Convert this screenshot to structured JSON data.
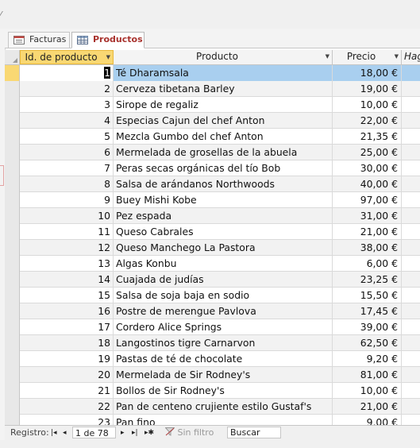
{
  "tabs": [
    {
      "label": "Facturas",
      "active": false
    },
    {
      "label": "Productos",
      "active": true
    }
  ],
  "columns": {
    "id": "Id. de producto",
    "name": "Producto",
    "price": "Precio",
    "extra": "Hag"
  },
  "rows": [
    {
      "id": "1",
      "name": "Té Dharamsala",
      "price": "18,00 €"
    },
    {
      "id": "2",
      "name": "Cerveza tibetana Barley",
      "price": "19,00 €"
    },
    {
      "id": "3",
      "name": "Sirope de regaliz",
      "price": "10,00 €"
    },
    {
      "id": "4",
      "name": "Especias Cajun del chef Anton",
      "price": "22,00 €"
    },
    {
      "id": "5",
      "name": "Mezcla Gumbo del chef Anton",
      "price": "21,35 €"
    },
    {
      "id": "6",
      "name": "Mermelada de grosellas de la abuela",
      "price": "25,00 €"
    },
    {
      "id": "7",
      "name": "Peras secas orgánicas del tío Bob",
      "price": "30,00 €"
    },
    {
      "id": "8",
      "name": "Salsa de arándanos Northwoods",
      "price": "40,00 €"
    },
    {
      "id": "9",
      "name": "Buey Mishi Kobe",
      "price": "97,00 €"
    },
    {
      "id": "10",
      "name": "Pez espada",
      "price": "31,00 €"
    },
    {
      "id": "11",
      "name": "Queso Cabrales",
      "price": "21,00 €"
    },
    {
      "id": "12",
      "name": "Queso Manchego La Pastora",
      "price": "38,00 €"
    },
    {
      "id": "13",
      "name": "Algas Konbu",
      "price": "6,00 €"
    },
    {
      "id": "14",
      "name": "Cuajada de judías",
      "price": "23,25 €"
    },
    {
      "id": "15",
      "name": "Salsa de soja baja en sodio",
      "price": "15,50 €"
    },
    {
      "id": "16",
      "name": "Postre de merengue Pavlova",
      "price": "17,45 €"
    },
    {
      "id": "17",
      "name": "Cordero Alice Springs",
      "price": "39,00 €"
    },
    {
      "id": "18",
      "name": "Langostinos tigre Carnarvon",
      "price": "62,50 €"
    },
    {
      "id": "19",
      "name": "Pastas de té de chocolate",
      "price": "9,20 €"
    },
    {
      "id": "20",
      "name": "Mermelada de Sir Rodney's",
      "price": "81,00 €"
    },
    {
      "id": "21",
      "name": "Bollos de Sir Rodney's",
      "price": "10,00 €"
    },
    {
      "id": "22",
      "name": "Pan de centeno crujiente estilo Gustaf's",
      "price": "21,00 €"
    },
    {
      "id": "23",
      "name": "Pan fino",
      "price": "9,00 €"
    }
  ],
  "nav": {
    "label": "Registro:",
    "record": "1 de 78",
    "filter": "Sin filtro",
    "search": "Buscar",
    "first": "|◂",
    "prev": "◂",
    "next": "▸",
    "last": "▸|",
    "new": "▸✱"
  },
  "colors": {
    "active_tab": "#a8322d",
    "selected_row": "#a9cfef",
    "sorted_header": "#f9d873"
  }
}
